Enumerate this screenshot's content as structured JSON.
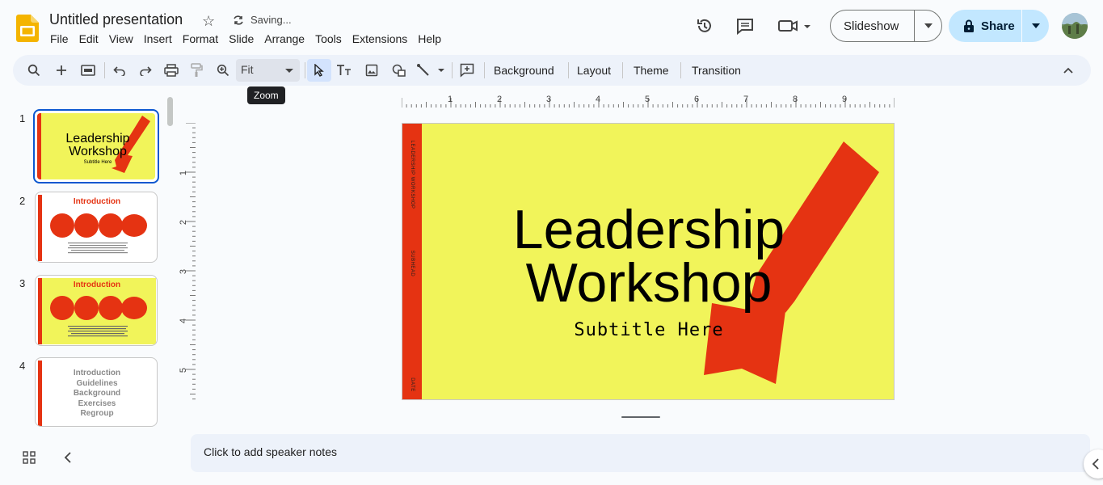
{
  "app": {
    "doc_title": "Untitled presentation",
    "saving_status": "Saving...",
    "menu": [
      "File",
      "Edit",
      "View",
      "Insert",
      "Format",
      "Slide",
      "Arrange",
      "Tools",
      "Extensions",
      "Help"
    ],
    "slideshow_label": "Slideshow",
    "share_label": "Share"
  },
  "toolbar": {
    "zoom_value": "Fit",
    "background_label": "Background",
    "layout_label": "Layout",
    "theme_label": "Theme",
    "transition_label": "Transition",
    "tooltip": "Zoom"
  },
  "ruler": {
    "h_marks": [
      "1",
      "2",
      "3",
      "4",
      "5",
      "6",
      "7",
      "8",
      "9"
    ],
    "v_marks": [
      "1",
      "2",
      "3",
      "4",
      "5"
    ]
  },
  "slides": [
    {
      "number": "1",
      "title": "Leadership Workshop",
      "title_line1": "Leadership",
      "title_line2": "Workshop",
      "subtitle": "Subtitle Here"
    },
    {
      "number": "2",
      "title": "Introduction"
    },
    {
      "number": "3",
      "title": "Introduction"
    },
    {
      "number": "4",
      "lines": [
        "Introduction",
        "Guidelines",
        "Background",
        "Exercises",
        "Regroup"
      ]
    }
  ],
  "current_slide": {
    "title_line1": "Leadership",
    "title_line2": "Workshop",
    "subtitle": "Subtitle Here",
    "side_labels": [
      "LEADERSHIP WORKSHOP",
      "SUBHEAD",
      "DATE"
    ]
  },
  "notes": {
    "placeholder": "Click to add speaker notes"
  },
  "colors": {
    "slide_bg": "#f1f45a",
    "accent_red": "#e53312",
    "share_bg": "#c2e7ff",
    "toolbar_bg": "#edf2fa",
    "active_thumb_border": "#0b57d0"
  }
}
